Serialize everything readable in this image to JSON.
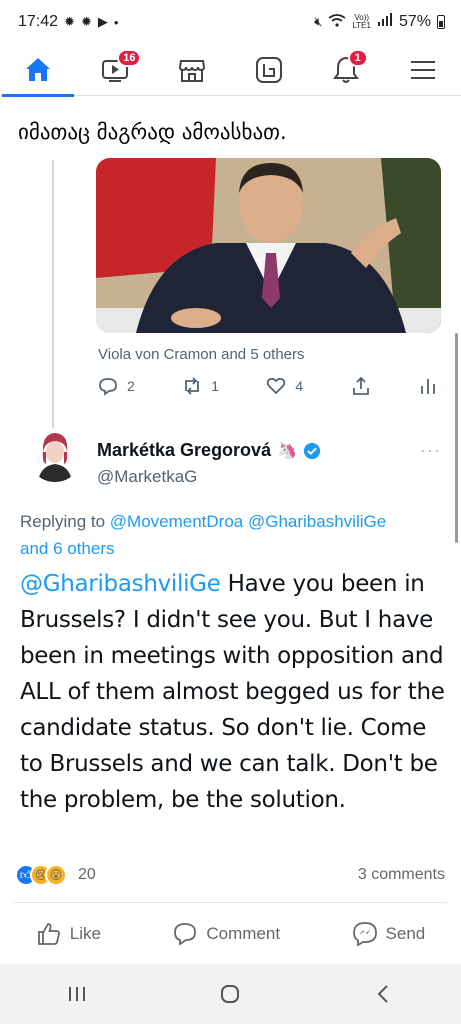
{
  "status_bar": {
    "time": "17:42",
    "left_icons": [
      "gear-icon",
      "gear-icon",
      "youtube-icon",
      "dot-icon"
    ],
    "volte": "Vo))\nLTE1",
    "battery": "57%"
  },
  "fb_nav": {
    "tabs": [
      {
        "name": "home-icon",
        "active": true
      },
      {
        "name": "watch-icon",
        "badge": "16"
      },
      {
        "name": "marketplace-icon"
      },
      {
        "name": "groups-icon"
      },
      {
        "name": "notifications-icon",
        "badge": "1"
      },
      {
        "name": "menu-icon"
      }
    ],
    "accent": "#1877f2"
  },
  "post": {
    "text": "იმათაც მაგრად ამოასხათ."
  },
  "quoted_tweet": {
    "likers": "Viola von Cramon and 5 others",
    "replies": "2",
    "retweets": "1",
    "likes": "4"
  },
  "reply_tweet": {
    "author_name": "Markétka Gregorová",
    "author_emoji": "🦄",
    "handle": "@MarketkaG",
    "replying_label": "Replying to ",
    "replying_to": "@MovementDroa @GharibashviliGe",
    "replying_more": "and 6 others",
    "mention": "@GharibashviliGe",
    "body": " Have you been in Brussels? I didn't see you. But I have been in meetings with opposition and ALL of them almost begged us for the candidate status. So don't lie. Come to Brussels and we can talk. Don't be the problem, be the solution."
  },
  "reactions": {
    "count": "20",
    "comments": "3 comments"
  },
  "actions": {
    "like": "Like",
    "comment": "Comment",
    "send": "Send"
  }
}
